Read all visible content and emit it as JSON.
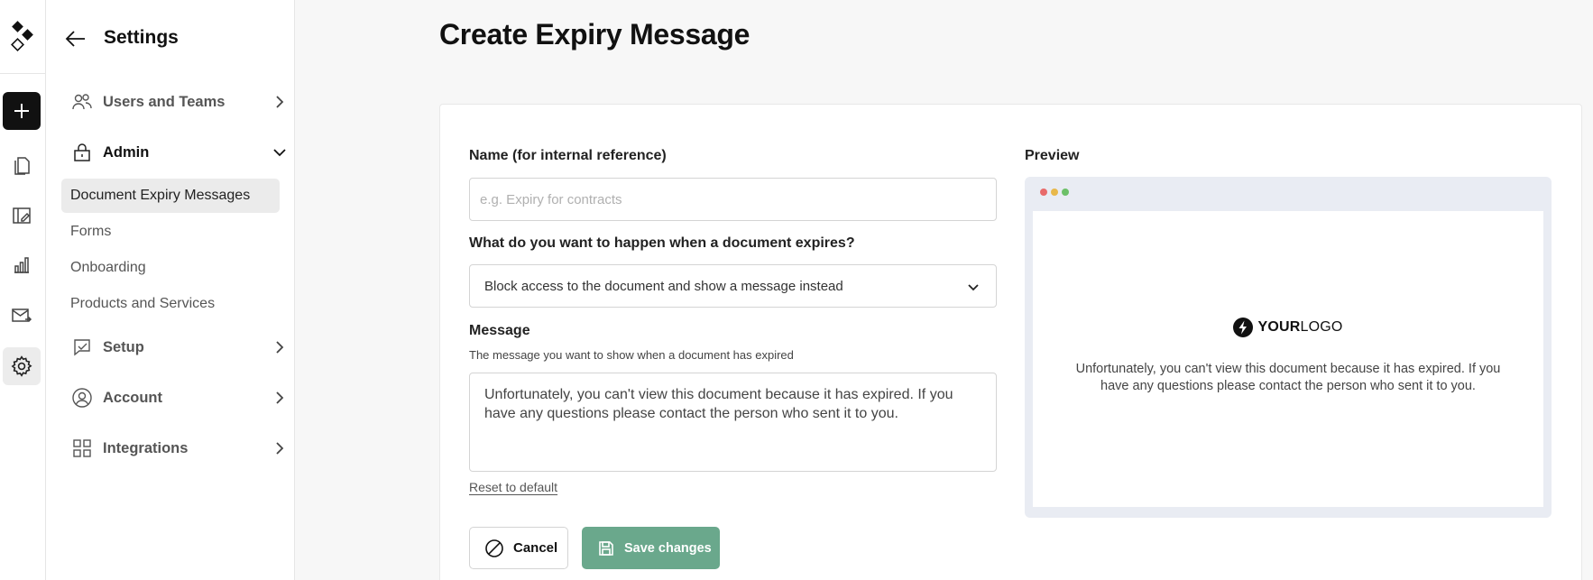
{
  "sidebar": {
    "title": "Settings",
    "groups": {
      "users": "Users and Teams",
      "admin": "Admin",
      "setup": "Setup",
      "account": "Account",
      "integrations": "Integrations"
    },
    "admin_items": [
      "Document Expiry Messages",
      "Forms",
      "Onboarding",
      "Products and Services"
    ]
  },
  "page": {
    "title": "Create Expiry Message"
  },
  "form": {
    "name_label": "Name (for internal reference)",
    "name_placeholder": "e.g. Expiry for contracts",
    "name_value": "",
    "action_label": "What do you want to happen when a document expires?",
    "action_value": "Block access to the document and show a message instead",
    "message_label": "Message",
    "message_hint": "The message you want to show when a document has expired",
    "message_value": "Unfortunately, you can't view this document because it has expired. If you have any questions please contact the person who sent it to you.",
    "reset_label": "Reset to default",
    "cancel_label": "Cancel",
    "save_label": "Save changes"
  },
  "preview": {
    "label": "Preview",
    "logo_bold": "YOUR",
    "logo_light": "LOGO",
    "message": "Unfortunately, you can't view this document because it has expired. If you have any questions please contact the person who sent it to you."
  },
  "colors": {
    "primary_button": "#6aa88c",
    "dot_red": "#e86a6a",
    "dot_yellow": "#e8b84a",
    "dot_green": "#6cc068"
  }
}
